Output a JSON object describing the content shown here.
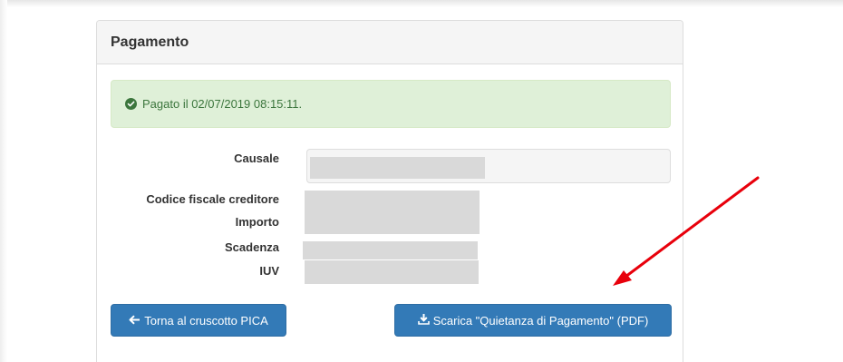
{
  "panel": {
    "title": "Pagamento"
  },
  "alert": {
    "icon": "check-circle-icon",
    "message": "Pagato il 02/07/2019 08:15:11.",
    "color": "#3c763d",
    "background": "#dff0d8"
  },
  "fields": {
    "causale_label": "Causale",
    "codice_fiscale_label": "Codice fiscale creditore",
    "importo_label": "Importo",
    "scadenza_label": "Scadenza",
    "iuv_label": "IUV"
  },
  "buttons": {
    "back_label": "Torna al cruscotto PICA",
    "back_icon": "arrow-left-icon",
    "download_label": "Scarica \"Quietanza di Pagamento\" (PDF)",
    "download_icon": "download-icon",
    "color": "#337ab7"
  },
  "annotation": {
    "arrow_color": "#e8000b"
  }
}
